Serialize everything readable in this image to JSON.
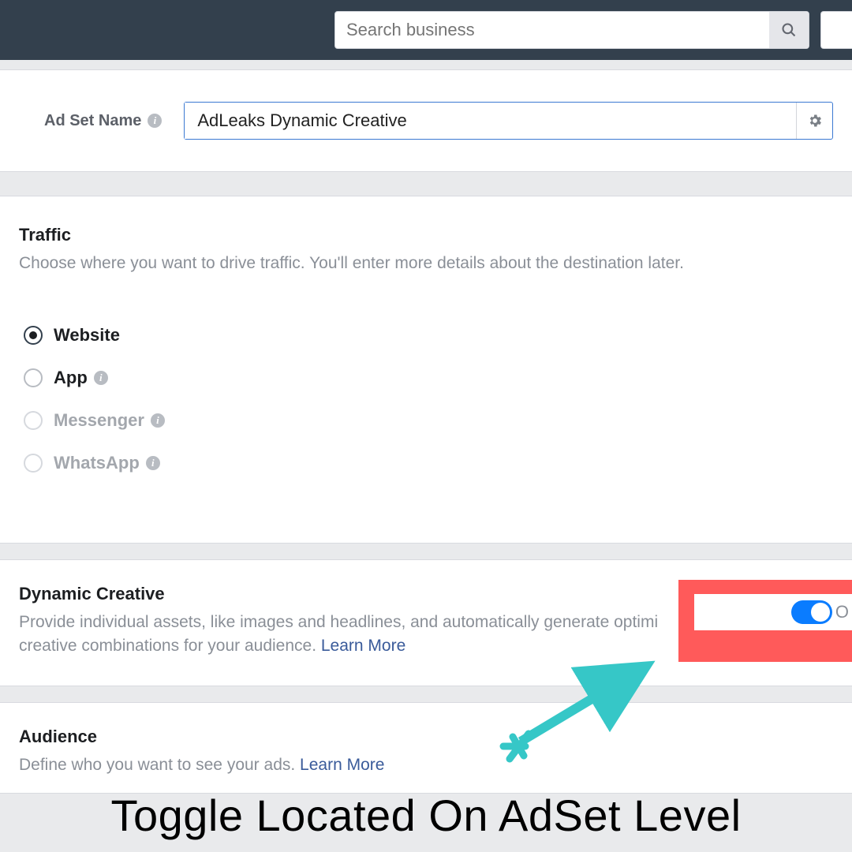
{
  "search": {
    "placeholder": "Search business"
  },
  "adSet": {
    "label": "Ad Set Name",
    "value": "AdLeaks Dynamic Creative "
  },
  "traffic": {
    "heading": "Traffic",
    "sub": "Choose where you want to drive traffic. You'll enter more details about the destination later.",
    "options": {
      "website": "Website",
      "app": "App",
      "messenger": "Messenger",
      "whatsapp": "WhatsApp"
    }
  },
  "dynamic": {
    "heading": "Dynamic Creative",
    "sub_pre": "Provide individual assets, like images and headlines, and automatically generate optimi",
    "sub_post": "creative combinations for your audience. ",
    "learn": "Learn More",
    "toggle_char": "O"
  },
  "audience": {
    "heading": "Audience",
    "sub": "Define who you want to see your ads. ",
    "learn": "Learn More"
  },
  "caption": "Toggle Located On AdSet Level"
}
